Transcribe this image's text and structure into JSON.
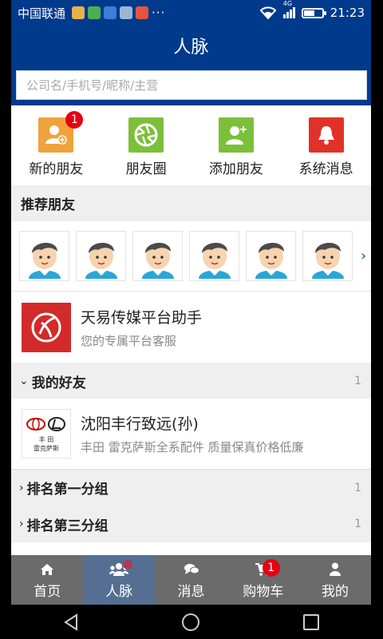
{
  "status_bar": {
    "carrier": "中国联通",
    "more": "···",
    "network": "4G",
    "time": "21:23",
    "battery_level": 0.6,
    "app_icon_colors": [
      "#e8b04a",
      "#4caf50",
      "#3b7fd6",
      "#9bb7d4",
      "#e6543c"
    ]
  },
  "header": {
    "title": "人脉",
    "search_placeholder": "公司名/手机号/昵称/主营"
  },
  "quick_actions": [
    {
      "label": "新的朋友",
      "icon": "person-plus-icon",
      "color": "#f0a23c",
      "badge": "1"
    },
    {
      "label": "朋友圈",
      "icon": "aperture-icon",
      "color": "#7cbf3a"
    },
    {
      "label": "添加朋友",
      "icon": "person-add-icon",
      "color": "#7cbf3a"
    },
    {
      "label": "系统消息",
      "icon": "bell-icon",
      "color": "#e03228"
    }
  ],
  "recommend": {
    "title": "推荐朋友",
    "avatar_count": 6,
    "more_icon": "chevron-right-icon"
  },
  "assistant": {
    "name": "天易传媒平台助手",
    "desc": "您的专属平台客服",
    "logo_color": "#d32a2a"
  },
  "friends_group": {
    "arrow": "⌄",
    "title": "我的好友",
    "count": "1"
  },
  "friend": {
    "name": "沈阳丰行致远(孙)",
    "desc": "丰田 雷克萨斯全系配件 质量保真价格低廉",
    "logo_text_1": "丰 田",
    "logo_text_2": "雷克萨斯"
  },
  "groups": [
    {
      "arrow": "›",
      "title": "排名第一分组",
      "count": "1"
    },
    {
      "arrow": "›",
      "title": "排名第三分组",
      "count": "1"
    }
  ],
  "tabs": [
    {
      "label": "首页",
      "icon": "home-icon"
    },
    {
      "label": "人脉",
      "icon": "people-icon",
      "active": true
    },
    {
      "label": "消息",
      "icon": "chat-icon"
    },
    {
      "label": "购物车",
      "icon": "cart-icon",
      "badge": "1"
    },
    {
      "label": "我的",
      "icon": "user-icon"
    }
  ],
  "colors": {
    "header": "#003a8c",
    "tabbar": "#6b6b6b",
    "tab_active": "#546f92",
    "badge": "#e60012"
  }
}
